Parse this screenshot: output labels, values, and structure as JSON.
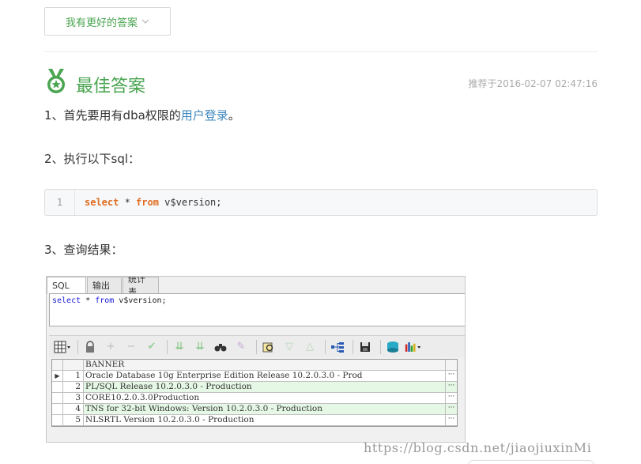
{
  "better_answer": {
    "label": "我有更好的答案",
    "chevron_icon": "chevron-down-icon"
  },
  "best_answer": {
    "title": "最佳答案",
    "recommend_time": "推荐于2016-02-07 02:47:16",
    "icon": "medal-icon",
    "accent_color": "#4aa551"
  },
  "steps": {
    "step1_prefix": "1、首先要用有dba权限的",
    "step1_link": "用户登录",
    "step1_suffix": "。",
    "step2": "2、执行以下sql：",
    "step3": "3、查询结果："
  },
  "code": {
    "line_no": "1",
    "kw_select": "select",
    "mid": " * ",
    "kw_from": "from",
    "rest": " v$version;"
  },
  "screenshot": {
    "tabs": [
      "SQL",
      "输出",
      "统计表"
    ],
    "sql_kw_select": "select",
    "sql_mid": " * ",
    "sql_kw_from": "from",
    "sql_rest": " v$version;",
    "column_header": "BANNER",
    "rows": [
      {
        "num": "1",
        "value": "Oracle Database 10g Enterprise Edition Release 10.2.0.3.0 - Prod"
      },
      {
        "num": "2",
        "value": "PL/SQL Release 10.2.0.3.0 - Production"
      },
      {
        "num": "3",
        "value": "CORE10.2.0.3.0Production"
      },
      {
        "num": "4",
        "value": "TNS for 32-bit Windows: Version 10.2.0.3.0 - Production"
      },
      {
        "num": "5",
        "value": "NLSRTL Version 10.2.0.3.0 - Production"
      }
    ],
    "cell_more": "···",
    "current_row_icon": "▶"
  },
  "watermark": "https://blog.csdn.net/jiaojiuxinMi"
}
